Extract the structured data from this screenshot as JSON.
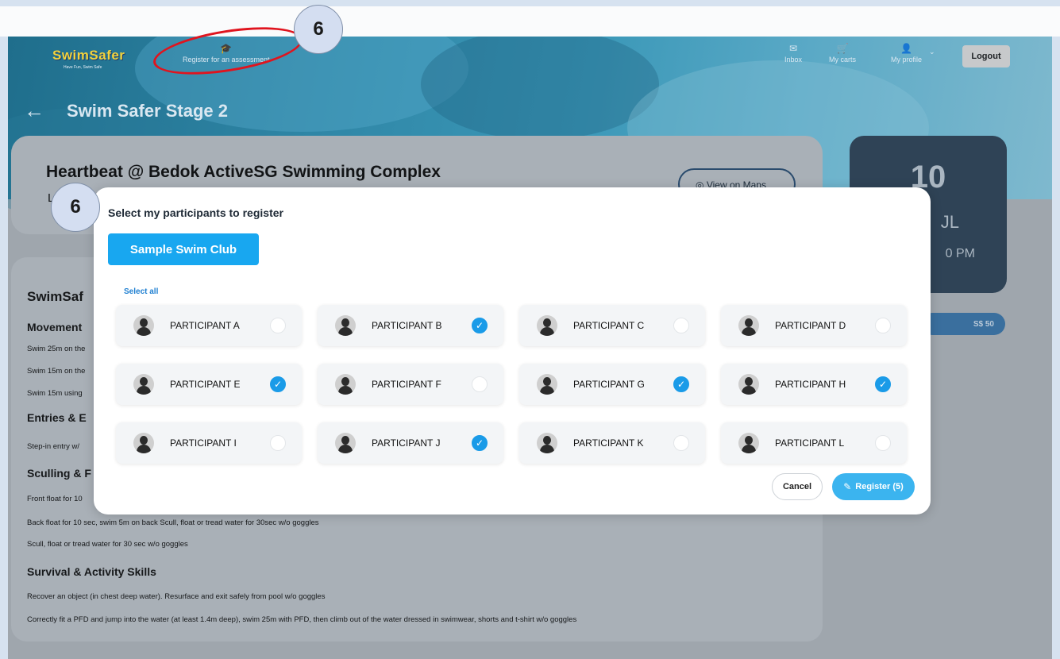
{
  "header": {
    "logo": "SwimSafer",
    "logo_tagline": "Have Fun, Swim Safe",
    "register_assessment": "Register for an assessment",
    "inbox": "Inbox",
    "my_carts": "My carts",
    "my_profile": "My profile",
    "logout": "Logout"
  },
  "page": {
    "title": "Swim Safer Stage 2"
  },
  "venue": {
    "name": "Heartbeat @ Bedok ActiveSG Swimming Complex",
    "location_initial": "L",
    "view_on_maps": "View on Maps"
  },
  "date_card": {
    "day": "10",
    "month_partial": "JL",
    "time_partial": "0 PM"
  },
  "price": "S$ 50",
  "skills": {
    "heading_partial": "SwimSaf",
    "sections": [
      {
        "title": "Movement",
        "lines": [
          "Swim 25m on the",
          "Swim 15m on the",
          "Swim 15m using"
        ]
      },
      {
        "title": "Entries & E",
        "lines": [
          "Step-in entry w/"
        ]
      },
      {
        "title": "Sculling & F",
        "lines": [
          "Front float for 10",
          "Back float for 10 sec, swim 5m on back Scull, float or tread water for 30sec w/o goggles",
          "Scull, float or tread water for 30 sec w/o goggles"
        ]
      },
      {
        "title": "Survival & Activity Skills",
        "lines": [
          "Recover an object (in chest deep water). Resurface and exit safely from pool w/o goggles",
          "Correctly fit a PFD and jump into the water (at least 1.4m deep), swim 25m with PFD, then climb out of the water dressed in swimwear, shorts and t-shirt w/o goggles"
        ]
      }
    ]
  },
  "modal": {
    "title": "Select my participants to register",
    "club": "Sample Swim Club",
    "select_all": "Select all",
    "participants": [
      {
        "name": "PARTICIPANT A",
        "checked": false
      },
      {
        "name": "PARTICIPANT B",
        "checked": true
      },
      {
        "name": "PARTICIPANT C",
        "checked": false
      },
      {
        "name": "PARTICIPANT D",
        "checked": false
      },
      {
        "name": "PARTICIPANT E",
        "checked": true
      },
      {
        "name": "PARTICIPANT F",
        "checked": false
      },
      {
        "name": "PARTICIPANT G",
        "checked": true
      },
      {
        "name": "PARTICIPANT H",
        "checked": true
      },
      {
        "name": "PARTICIPANT I",
        "checked": false
      },
      {
        "name": "PARTICIPANT J",
        "checked": true
      },
      {
        "name": "PARTICIPANT K",
        "checked": false
      },
      {
        "name": "PARTICIPANT L",
        "checked": false
      }
    ],
    "cancel": "Cancel",
    "register": "Register (5)",
    "check_glyph": "✓"
  },
  "annotations": {
    "step_top": "6",
    "step_modal": "6"
  },
  "colors": {
    "primary_blue": "#18a7f0",
    "check_blue": "#1a9be8",
    "annotation_red": "#e0141e"
  }
}
